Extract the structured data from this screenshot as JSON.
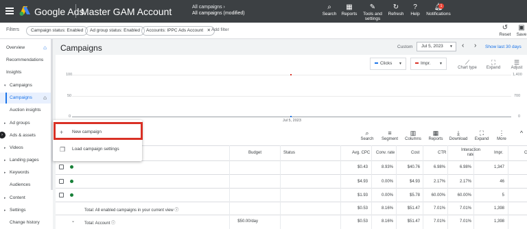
{
  "topbar": {
    "brand": "Google Ads",
    "account": "Master GAM Account",
    "breadcrumb_parent": "All campaigns",
    "breadcrumb_current": "All campaigns (modified)",
    "tools": [
      {
        "label": "Search",
        "icon": "search-icon"
      },
      {
        "label": "Reports",
        "icon": "reports-icon"
      },
      {
        "label": "Tools and settings",
        "icon": "wrench-icon"
      },
      {
        "label": "Refresh",
        "icon": "refresh-icon"
      },
      {
        "label": "Help",
        "icon": "help-icon"
      },
      {
        "label": "Notifications",
        "icon": "bell-icon",
        "badge": "1"
      }
    ]
  },
  "filters": {
    "label": "Filters",
    "chips": [
      "Campaign status: Enabled",
      "Ad group status: Enabled",
      "Accounts: IPPC Ads Account"
    ],
    "add_filter": "Add filter",
    "reset": "Reset",
    "save": "Save"
  },
  "sidebar": {
    "items": [
      {
        "label": "Overview",
        "home": true
      },
      {
        "label": "Recommendations"
      },
      {
        "label": "Insights"
      },
      {
        "label": "Campaigns",
        "section": true
      },
      {
        "label": "Campaigns",
        "active": true,
        "home": true
      },
      {
        "label": "Auction insights"
      },
      {
        "label": "Ad groups",
        "section": true
      },
      {
        "label": "Ads & assets",
        "section": true
      },
      {
        "label": "Videos",
        "section": true
      },
      {
        "label": "Landing pages",
        "section": true
      },
      {
        "label": "Keywords",
        "section": true
      },
      {
        "label": "Audiences"
      },
      {
        "label": "Content",
        "section": true
      },
      {
        "label": "Settings",
        "section": true
      },
      {
        "label": "Change history"
      }
    ]
  },
  "header": {
    "title": "Campaigns",
    "custom_label": "Custom",
    "date_value": "Jul 5, 2023",
    "show_last": "Show last 30 days"
  },
  "chart_controls": {
    "metric1": "Clicks",
    "metric2": "Impr.",
    "tools": [
      {
        "label": "Chart type",
        "icon": "chart-type-icon"
      },
      {
        "label": "Expand",
        "icon": "expand-icon"
      },
      {
        "label": "Adjust",
        "icon": "adjust-icon"
      }
    ]
  },
  "chart_data": {
    "type": "line",
    "x": [
      "Jul 5, 2023"
    ],
    "series": [
      {
        "name": "Clicks",
        "values": [
          0
        ]
      },
      {
        "name": "Impr.",
        "values": [
          1398
        ]
      }
    ],
    "left_ticks": [
      "100",
      "50",
      "0"
    ],
    "right_ticks": [
      "1,400",
      "700",
      "0"
    ],
    "xlabel": "Jul 5, 2023",
    "colors": {
      "clicks": "#1a73e8",
      "impr": "#d93025"
    }
  },
  "table_tools": [
    {
      "label": "Search",
      "icon": "search-icon"
    },
    {
      "label": "Segment",
      "icon": "segment-icon"
    },
    {
      "label": "Columns",
      "icon": "columns-icon"
    },
    {
      "label": "Reports",
      "icon": "reports-icon"
    },
    {
      "label": "Download",
      "icon": "download-icon"
    },
    {
      "label": "Expand",
      "icon": "expand-icon"
    },
    {
      "label": "More",
      "icon": "more-icon"
    }
  ],
  "table": {
    "headers": {
      "budget": "Budget",
      "status": "Status",
      "avg_cpc": "Avg. CPC",
      "conv_rate": "Conv. rate",
      "cost": "Cost",
      "ctr": "CTR",
      "interaction_rate": "Interaction rate",
      "impr": "Impr.",
      "extra": "C"
    },
    "rows": [
      {
        "avg_cpc": "$0.43",
        "conv_rate": "8.93%",
        "cost": "$40.76",
        "ctr": "6.98%",
        "interaction_rate": "6.98%",
        "impr": "1,347"
      },
      {
        "avg_cpc": "$4.93",
        "conv_rate": "0.00%",
        "cost": "$4.93",
        "ctr": "2.17%",
        "interaction_rate": "2.17%",
        "impr": "46"
      },
      {
        "avg_cpc": "$1.93",
        "conv_rate": "0.00%",
        "cost": "$5.78",
        "ctr": "60.00%",
        "interaction_rate": "60.00%",
        "impr": "5"
      }
    ],
    "total_enabled": {
      "label": "Total: All enabled campaigns in your current view",
      "avg_cpc": "$0.53",
      "conv_rate": "8.16%",
      "cost": "$51.47",
      "ctr": "7.01%",
      "interaction_rate": "7.01%",
      "impr": "1,398"
    },
    "total_account": {
      "label": "Total: Account",
      "budget": "$50.00/day",
      "avg_cpc": "$0.53",
      "conv_rate": "8.16%",
      "cost": "$51.47",
      "ctr": "7.01%",
      "interaction_rate": "7.01%",
      "impr": "1,398"
    }
  },
  "popup": {
    "new_campaign": "New campaign",
    "load_settings": "Load campaign settings"
  }
}
